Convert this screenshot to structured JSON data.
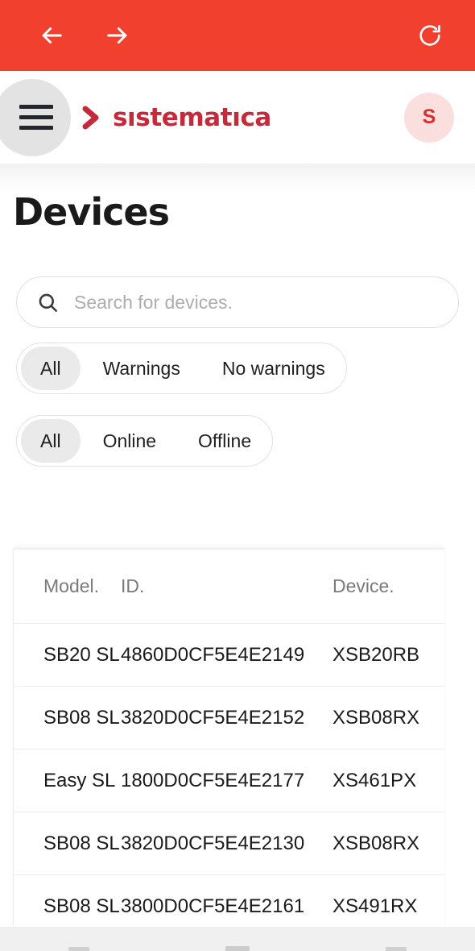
{
  "browser": {
    "back_icon": "arrow-left-icon",
    "forward_icon": "arrow-right-icon",
    "reload_icon": "reload-icon",
    "bar_color": "#F1402E"
  },
  "header": {
    "menu_icon": "hamburger-menu-icon",
    "logo_chevron_icon": "chevron-right-logo-icon",
    "brand": "sıstematıca",
    "brand_color": "#C5293A",
    "avatar_initial": "S",
    "avatar_bg": "#FBDFDF",
    "avatar_fg": "#DA2F2F"
  },
  "page": {
    "title": "Devices"
  },
  "search": {
    "icon": "search-icon",
    "placeholder": "Search for devices.",
    "value": ""
  },
  "filters": [
    {
      "name": "warning-filter",
      "options": [
        {
          "label": "All",
          "selected": true
        },
        {
          "label": "Warnings",
          "selected": false
        },
        {
          "label": "No warnings",
          "selected": false
        }
      ]
    },
    {
      "name": "status-filter",
      "options": [
        {
          "label": "All",
          "selected": true
        },
        {
          "label": "Online",
          "selected": false
        },
        {
          "label": "Offline",
          "selected": false
        }
      ]
    }
  ],
  "table": {
    "columns": [
      "Model.",
      "ID.",
      "Device."
    ],
    "rows": [
      {
        "model": "SB20 SL",
        "id": "4860D0CF5E4E2149",
        "device": "XSB20RB"
      },
      {
        "model": "SB08 SL",
        "id": "3820D0CF5E4E2152",
        "device": "XSB08RX"
      },
      {
        "model": "Easy SL",
        "id": "1800D0CF5E4E2177",
        "device": "XS461PX"
      },
      {
        "model": "SB08 SL",
        "id": "3820D0CF5E4E2130",
        "device": "XSB08RX"
      },
      {
        "model": "SB08 SL",
        "id": "3800D0CF5E4E2161",
        "device": "XS491RX"
      }
    ]
  }
}
